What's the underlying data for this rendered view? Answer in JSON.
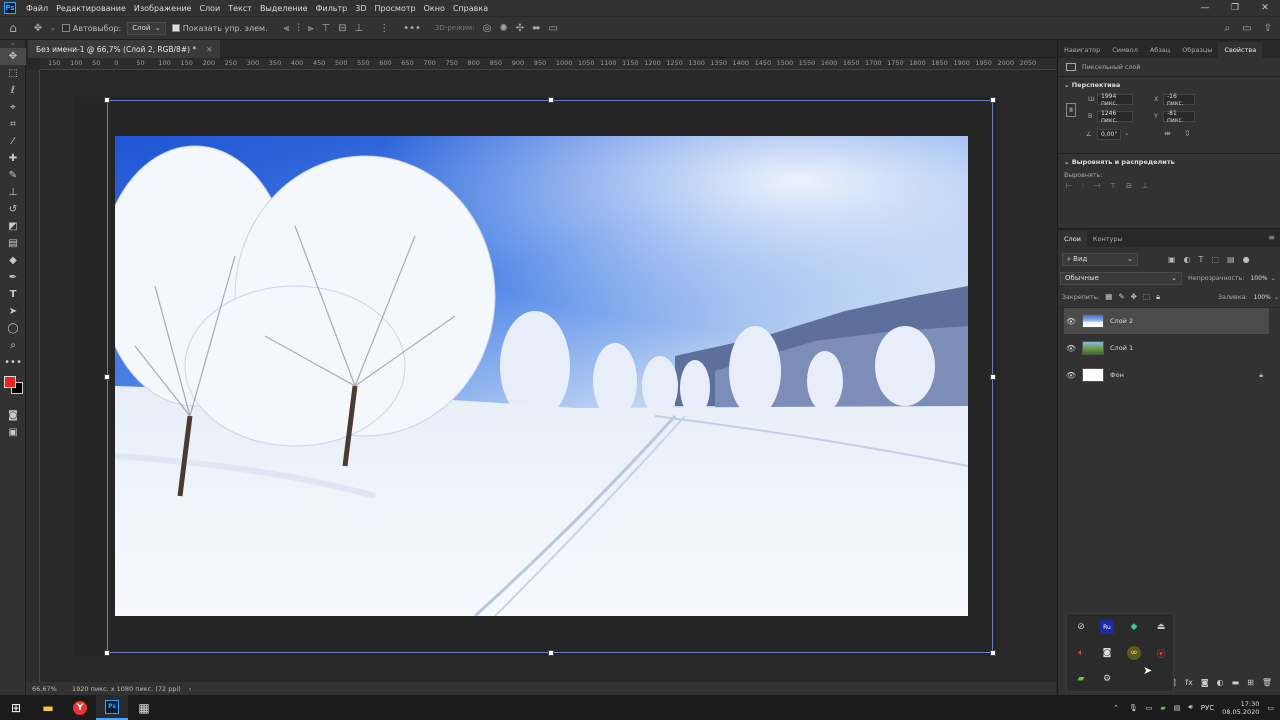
{
  "menu": {
    "logo": "Ps",
    "items": [
      "Файл",
      "Редактирование",
      "Изображение",
      "Слои",
      "Текст",
      "Выделение",
      "Фильтр",
      "3D",
      "Просмотр",
      "Окно",
      "Справка"
    ]
  },
  "options": {
    "autoselect_label": "Автовыбор:",
    "autoselect_value": "Слой",
    "show_controls_label": "Показать упр. элем.",
    "mode3d_label": "3D-режим:"
  },
  "document": {
    "tab_title": "Без имени-1 @ 66,7% (Слой 2, RGB/8#) *",
    "zoom": "66,67%",
    "info": "1920 пикс. x 1080 пикс. (72 ppi)"
  },
  "ruler": {
    "ticks": [
      "150",
      "100",
      "50",
      "0",
      "50",
      "100",
      "150",
      "200",
      "250",
      "300",
      "350",
      "400",
      "450",
      "500",
      "550",
      "600",
      "650",
      "700",
      "750",
      "800",
      "850",
      "900",
      "950",
      "1000",
      "1050",
      "1100",
      "1150",
      "1200",
      "1250",
      "1300",
      "1350",
      "1400",
      "1450",
      "1500",
      "1550",
      "1600",
      "1650",
      "1700",
      "1750",
      "1800",
      "1850",
      "1900",
      "1950",
      "2000",
      "2050"
    ]
  },
  "properties_panel": {
    "tabs": [
      "Навигатор",
      "Символ",
      "Абзац",
      "Образцы",
      "Свойства"
    ],
    "active_tab": "Свойства",
    "layer_type": "Пиксельный слой",
    "perspective_title": "Перспектива",
    "w_label": "Ш",
    "w_value": "1994 пикс.",
    "h_label": "В",
    "h_value": "1246 пикс.",
    "x_label": "X",
    "x_value": "-16 пикс.",
    "y_label": "Y",
    "y_value": "-81 пикс.",
    "angle_value": "0,00°",
    "align_title": "Выровнять и распределить",
    "align_label": "Выровнять:"
  },
  "layers_panel": {
    "tabs": [
      "Слои",
      "Контуры"
    ],
    "filter_value": "Вид",
    "blend_mode": "Обычные",
    "opacity_label": "Непрозрачность:",
    "opacity_value": "100%",
    "lock_label": "Закрепить:",
    "fill_label": "Заливка:",
    "fill_value": "100%",
    "layers": [
      {
        "name": "Слой 2",
        "selected": true,
        "thumb": "winter"
      },
      {
        "name": "Слой 1",
        "selected": false,
        "thumb": "green"
      },
      {
        "name": "Фон",
        "selected": false,
        "thumb": "white",
        "locked": true
      }
    ]
  },
  "taskbar": {
    "lang": "РУС",
    "time": "17:30",
    "date": "08.05.2020"
  },
  "colors": {
    "foreground": "#e8231e",
    "background": "#000000",
    "accent": "#6a7cc4"
  }
}
